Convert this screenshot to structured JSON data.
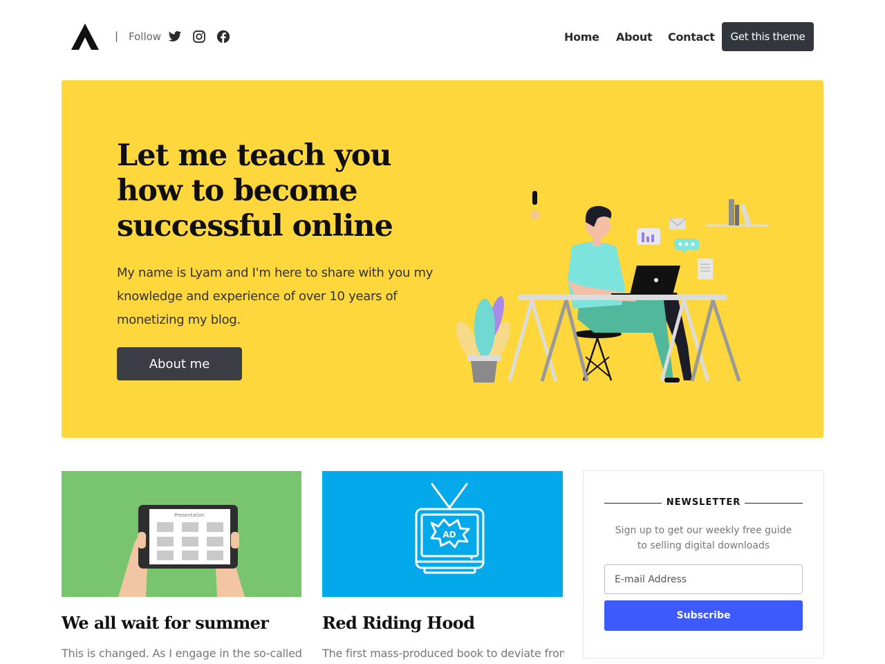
{
  "header": {
    "logo": "a-logo-icon",
    "separator": "|",
    "follow_label": "Follow",
    "social_icons": [
      "twitter-icon",
      "instagram-icon",
      "facebook-icon"
    ],
    "nav": [
      {
        "label": "Home"
      },
      {
        "label": "About"
      },
      {
        "label": "Contact"
      }
    ],
    "cta_label": "Get this theme"
  },
  "hero": {
    "title": "Let me teach you how to become successful online",
    "text": "My name is Lyam and I'm here to share with you my knowledge and experience of over 10 years of monetizing my blog.",
    "button_label": "About me",
    "background_color": "#fdd73c",
    "tablet_caption": "",
    "illustration": "person-at-desk-illustration"
  },
  "cards": [
    {
      "title": "We all wait for summer",
      "excerpt": "This is changed. As I engage in the so-called",
      "image": "tablet-presentation-illustration",
      "image_caption": "Presentation",
      "image_bg": "#79c46f"
    },
    {
      "title": "Red Riding Hood",
      "excerpt": "The first mass-produced book to deviate from a",
      "image": "tv-ad-illustration",
      "image_caption": "AD",
      "image_bg": "#03a9ea"
    }
  ],
  "newsletter": {
    "heading": "NEWSLETTER",
    "text": "Sign up to get our weekly free guide to selling digital downloads",
    "input_placeholder": "E-mail Address",
    "button_label": "Subscribe",
    "button_color": "#3d5afe"
  }
}
